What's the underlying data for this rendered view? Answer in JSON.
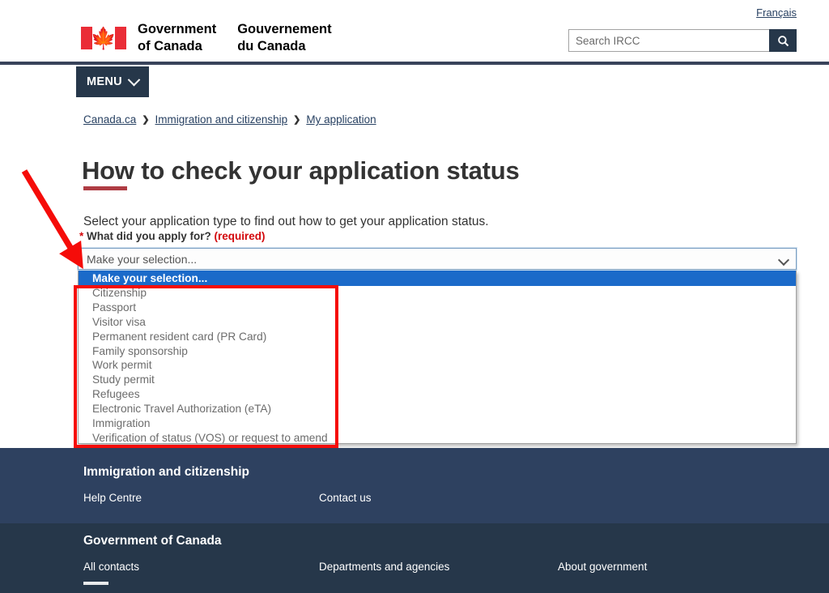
{
  "header": {
    "language_link": "Français",
    "brand_en": "Government\nof Canada",
    "brand_fr": "Gouvernement\ndu Canada",
    "flag_icon": "canada-flag-icon",
    "search": {
      "placeholder": "Search IRCC",
      "value": "",
      "button_icon": "search-icon"
    }
  },
  "nav": {
    "menu_label": "MENU",
    "menu_icon": "chevron-down-icon"
  },
  "breadcrumb": {
    "items": [
      {
        "label": "Canada.ca"
      },
      {
        "label": "Immigration and citizenship"
      },
      {
        "label": "My application"
      }
    ],
    "separator": "❯"
  },
  "main": {
    "title": "How to check your application status",
    "lede": "Select your application type to find out how to get your application status.",
    "field": {
      "star": "*",
      "label": "What did you apply for?",
      "required_text": "(required)",
      "selected_value": "Make your selection...",
      "dropdown_icon": "chevron-down-icon",
      "options": [
        "Make your selection...",
        "Citizenship",
        "Passport",
        "Visitor visa",
        "Permanent resident card (PR Card)",
        "Family sponsorship",
        "Work permit",
        "Study permit",
        "Refugees",
        "Electronic Travel Authorization (eTA)",
        "Immigration",
        "Verification of status (VOS) or request to amend"
      ],
      "selected_index": 0
    }
  },
  "footer": {
    "section_one": {
      "heading": "Immigration and citizenship",
      "links": [
        "Help Centre",
        "Contact us"
      ]
    },
    "section_two": {
      "heading": "Government of Canada",
      "links": [
        "All contacts",
        "Departments and agencies",
        "About government"
      ]
    }
  },
  "annotations": {
    "arrow_color": "#f50c09",
    "rect_color": "#f50c09"
  },
  "colors": {
    "brand_navy": "#26374a",
    "footer_top": "#2e4160",
    "footer_bottom": "#26374a",
    "accent_red": "#af3c43",
    "required_red": "#d3080c",
    "highlight_blue": "#1b6ac9",
    "flag_red": "#ea2d37"
  }
}
